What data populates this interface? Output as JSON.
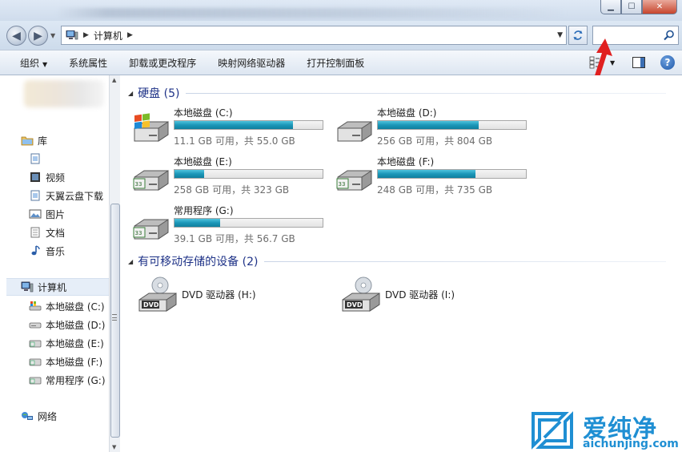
{
  "address": {
    "crumb": "计算机"
  },
  "search": {
    "placeholder": ""
  },
  "toolbar": {
    "organize": "组织",
    "system_properties": "系统属性",
    "uninstall": "卸载或更改程序",
    "map_drive": "映射网络驱动器",
    "control_panel": "打开控制面板"
  },
  "nav": {
    "libraries": "库",
    "videos": "视频",
    "tianyi": "天翼云盘下载",
    "pictures": "图片",
    "documents": "文档",
    "music": "音乐",
    "computer": "计算机",
    "drive_c": "本地磁盘 (C:)",
    "drive_d": "本地磁盘 (D:)",
    "drive_e": "本地磁盘 (E:)",
    "drive_f": "本地磁盘 (F:)",
    "drive_g": "常用程序 (G:)",
    "network": "网络"
  },
  "groups": {
    "hard_disks": "硬盘 (5)",
    "removable": "有可移动存储的设备 (2)"
  },
  "drives": [
    {
      "name": "本地磁盘 (C:)",
      "info": "11.1 GB 可用，共 55.0 GB",
      "used_fraction": 0.8
    },
    {
      "name": "本地磁盘 (D:)",
      "info": "256 GB 可用，共 804 GB",
      "used_fraction": 0.68
    },
    {
      "name": "本地磁盘 (E:)",
      "info": "258 GB 可用，共 323 GB",
      "used_fraction": 0.2
    },
    {
      "name": "本地磁盘 (F:)",
      "info": "248 GB 可用，共 735 GB",
      "used_fraction": 0.66
    },
    {
      "name": "常用程序 (G:)",
      "info": "39.1 GB 可用，共 56.7 GB",
      "used_fraction": 0.31
    }
  ],
  "dvds": [
    {
      "name": "DVD 驱动器 (H:)",
      "badge": "DVD"
    },
    {
      "name": "DVD 驱动器 (I:)",
      "badge": "DVD"
    }
  ],
  "watermark": {
    "text": "爱纯净",
    "url": "aichunjing.com"
  },
  "colors": {
    "bar_fill": "#1c97b8",
    "group_title": "#1e3287",
    "annotation": "#e02020",
    "watermark": "#1f8fd3"
  }
}
